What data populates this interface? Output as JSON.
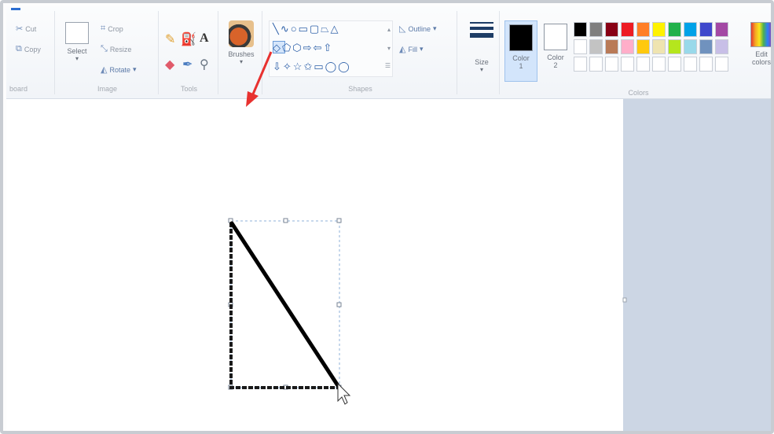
{
  "clipboard": {
    "cut": "Cut",
    "copy": "Copy",
    "group": "board"
  },
  "image": {
    "select": "Select",
    "crop": "Crop",
    "resize": "Resize",
    "rotate": "Rotate",
    "group": "Image"
  },
  "tools": {
    "group": "Tools",
    "text_tool": "A"
  },
  "brushes": {
    "label": "Brushes"
  },
  "shapes": {
    "group": "Shapes",
    "row1": "╲∿○▭▢⏢△",
    "row2": " ◇⬠⬡⇨⇦⇧",
    "row3": "⇩✧☆✩▭◯◯",
    "outline": "Outline",
    "fill": "Fill"
  },
  "size": {
    "label": "Size"
  },
  "colors": {
    "group": "Colors",
    "color1_label": "Color",
    "color1_num": "1",
    "color2_label": "Color",
    "color2_num": "2",
    "edit_label": "Edit",
    "edit_label2": "colors",
    "color1_value": "#000000",
    "color2_value": "#ffffff",
    "palette_row1": [
      "#000000",
      "#7f7f7f",
      "#880015",
      "#ed1c24",
      "#ff7f27",
      "#fff200",
      "#22b14c",
      "#00a2e8",
      "#3f48cc",
      "#a349a4"
    ],
    "palette_row2": [
      "#ffffff",
      "#c3c3c3",
      "#b97a57",
      "#ffaec9",
      "#ffc90e",
      "#efe4b0",
      "#b5e61d",
      "#99d9ea",
      "#7092be",
      "#c8bfe7"
    ],
    "palette_row3": [
      "#ffffff",
      "#ffffff",
      "#ffffff",
      "#ffffff",
      "#ffffff",
      "#ffffff",
      "#ffffff",
      "#ffffff",
      "#ffffff",
      "#ffffff"
    ]
  },
  "accent": {
    "arrow": "#e8312f",
    "selection": "#6b9bd8",
    "ribbon_text": "#6a717c"
  }
}
